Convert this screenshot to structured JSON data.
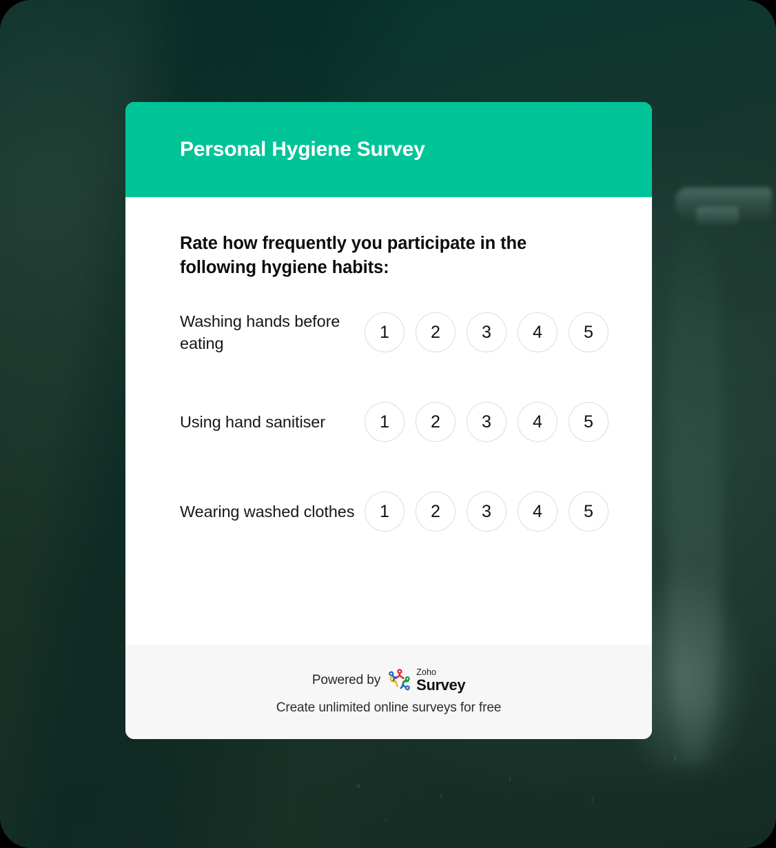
{
  "theme": {
    "header_color": "#00c498",
    "card_background": "#ffffff",
    "footer_background": "#f7f7f7",
    "page_background": "#2b4f42",
    "option_border_color": "#dcdcdc"
  },
  "survey": {
    "title": "Personal Hygiene Survey",
    "question": "Rate how frequently you participate in the following hygiene habits:",
    "scale": [
      "1",
      "2",
      "3",
      "4",
      "5"
    ],
    "rows": [
      {
        "label": "Washing hands before eating"
      },
      {
        "label": "Using hand sanitiser"
      },
      {
        "label": "Wearing washed clothes"
      }
    ]
  },
  "footer": {
    "powered_by": "Powered by",
    "brand_top": "Zoho",
    "brand_bottom": "Survey",
    "tagline": "Create unlimited online surveys for free",
    "logo_icon": "zoho-people-logo-icon",
    "logo_colors": {
      "red": "#e42527",
      "green": "#1a9c4b",
      "yellow": "#f9b21d",
      "blue": "#2369b9"
    }
  }
}
